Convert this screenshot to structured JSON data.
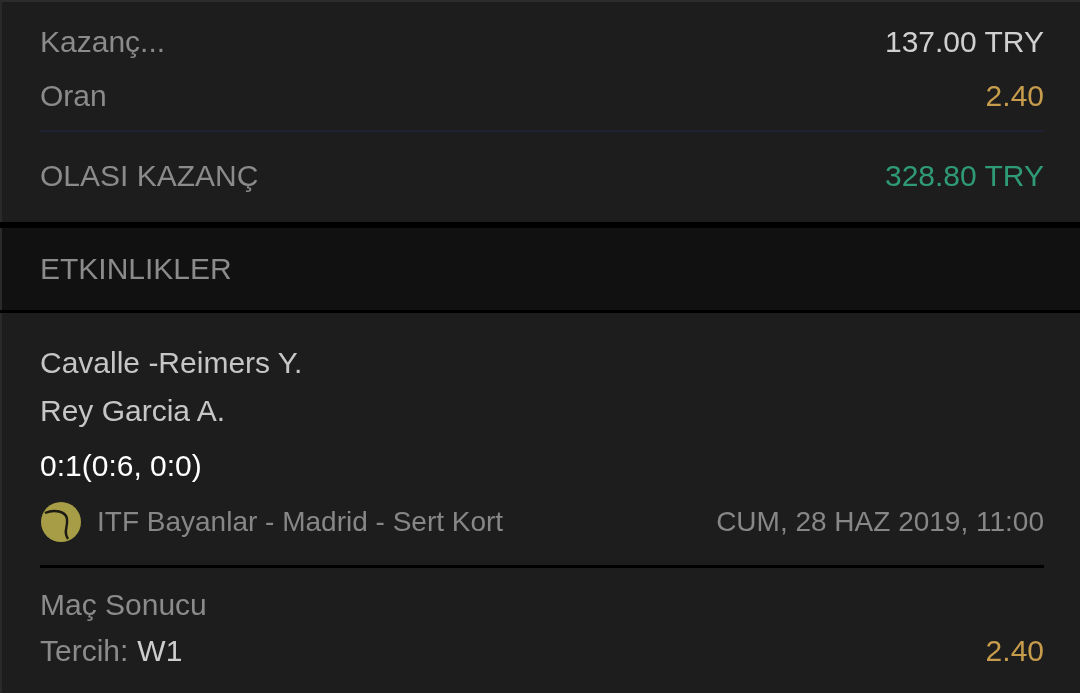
{
  "summary": {
    "rows": [
      {
        "kind": "amount",
        "label": "Kazanç...",
        "value": "137.00 TRY"
      },
      {
        "kind": "odds",
        "label": "Oran",
        "value": "2.40"
      }
    ],
    "total": {
      "label": "OLASI KAZANÇ",
      "value": "328.80 TRY"
    }
  },
  "events_header": "ETKINLIKLER",
  "events": [
    {
      "team_1": "Cavalle -Reimers Y.",
      "team_2": "Rey Garcia A.",
      "score": "0:1(0:6, 0:0)",
      "league": "ITF Bayanlar - Madrid - Sert Kort",
      "datetime": "CUM, 28 HAZ 2019, 11:00",
      "market": "Maç Sonucu",
      "pick_label": "Tercih:",
      "pick": "W1",
      "odds": "2.40"
    }
  ]
}
